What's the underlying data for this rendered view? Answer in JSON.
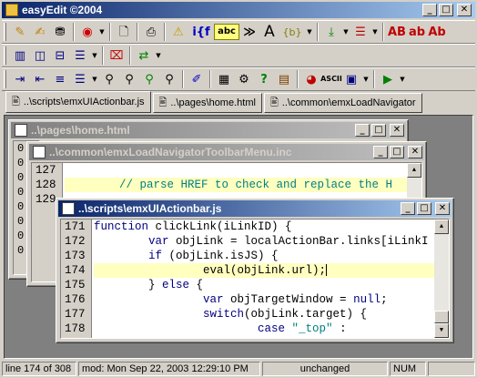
{
  "app": {
    "title": "easyEdit ©2004"
  },
  "toolbar1": {
    "icons": [
      "open-icon",
      "save-icon",
      "save-all-icon",
      "record-icon",
      "new-file-icon",
      "print-icon",
      "warning-icon",
      "brace-match-icon",
      "spell-check-icon",
      "indent-icon",
      "font-icon",
      "braces-icon",
      "arrow-icon",
      "format-icon"
    ],
    "labels": {
      "brace": "i{f",
      "abc": "abc",
      "font": "A",
      "braces": "{b}",
      "ab1": "AB",
      "ab2": "ab",
      "ab3": "Ab"
    }
  },
  "tabs": [
    {
      "label": "..\\scripts\\emxUIActionbar.js"
    },
    {
      "label": "..\\pages\\home.html"
    },
    {
      "label": "..\\common\\emxLoadNavigator"
    }
  ],
  "windows": {
    "home": {
      "title": "..\\pages\\home.html",
      "lines": [
        "0",
        "0",
        "0",
        "0",
        "0",
        "0",
        "0",
        "0"
      ]
    },
    "nav": {
      "title": "..\\common\\emxLoadNavigatorToolbarMenu.inc",
      "line_numbers": [
        "127",
        "128",
        "129"
      ],
      "lines": [
        "",
        "        // parse HREF to check and replace the H",
        ""
      ]
    },
    "action": {
      "title": "..\\scripts\\emxUIActionbar.js",
      "line_numbers": [
        "171",
        "172",
        "173",
        "174",
        "175",
        "176",
        "177",
        "178"
      ]
    }
  },
  "code": {
    "l171a": "function",
    "l171b": " clickLink(iLinkID) {",
    "l172a": "        var",
    "l172b": " objLink = localActionBar.links[iLinkI",
    "l173a": "        if",
    "l173b": " (objLink.isJS) {",
    "l174": "                eval(objLink.url);",
    "l175a": "        } ",
    "l175b": "else",
    "l175c": " {",
    "l176a": "                var",
    "l176b": " objTargetWindow = ",
    "l176c": "null",
    ";": ";",
    "l177a": "                switch",
    "l177b": "(objLink.target) {",
    "l178a": "                        case ",
    "l178b": "\"_top\"",
    "l178c": " :"
  },
  "status": {
    "line": "line 174 of 308",
    "mod": "mod: Mon Sep 22, 2003 12:29:10 PM",
    "state": "unchanged",
    "num": "NUM"
  }
}
